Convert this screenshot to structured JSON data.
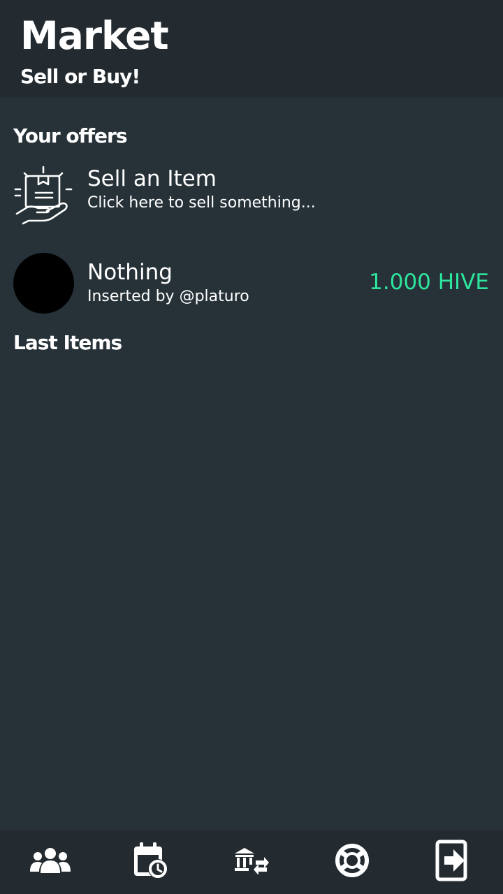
{
  "header": {
    "title": "Market",
    "subtitle": "Sell or Buy!"
  },
  "offers_section": {
    "title": "Your offers"
  },
  "sell_item": {
    "icon": "sell-item-icon",
    "label": "Sell an Item",
    "hint": "Click here to sell something..."
  },
  "offers": [
    {
      "name": "Nothing",
      "inserted_by": "Inserted by @platuro",
      "price": "1.000 HIVE"
    }
  ],
  "last_items_section": {
    "title": "Last Items"
  },
  "bottom_nav": [
    {
      "icon": "users-icon"
    },
    {
      "icon": "calendar-clock-icon"
    },
    {
      "icon": "bank-exchange-icon"
    },
    {
      "icon": "lifebuoy-icon"
    },
    {
      "icon": "logout-icon"
    }
  ],
  "colors": {
    "background": "#263238",
    "header": "#232b30",
    "price": "#2ee59d",
    "text": "#ffffff"
  }
}
